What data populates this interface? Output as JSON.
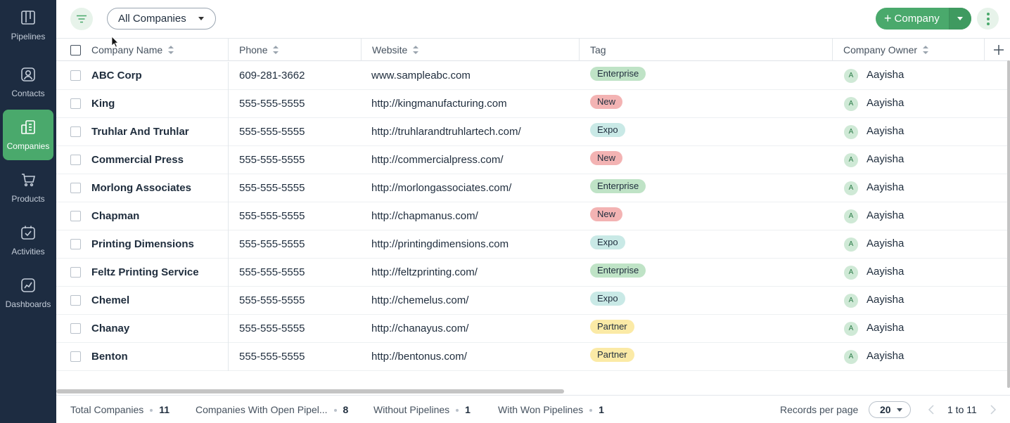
{
  "sidebar": {
    "items": [
      {
        "label": "Pipelines",
        "icon": "pipelines-icon",
        "active": false
      },
      {
        "label": "Contacts",
        "icon": "contacts-icon",
        "active": false
      },
      {
        "label": "Companies",
        "icon": "companies-icon",
        "active": true
      },
      {
        "label": "Products",
        "icon": "products-icon",
        "active": false
      },
      {
        "label": "Activities",
        "icon": "activities-icon",
        "active": false
      },
      {
        "label": "Dashboards",
        "icon": "dashboards-icon",
        "active": false
      }
    ]
  },
  "header": {
    "view_selector": "All Companies",
    "add_button_label": "Company"
  },
  "table": {
    "columns": [
      {
        "label": "Company Name",
        "sortable": true
      },
      {
        "label": "Phone",
        "sortable": true
      },
      {
        "label": "Website",
        "sortable": true
      },
      {
        "label": "Tag",
        "sortable": false
      },
      {
        "label": "Company Owner",
        "sortable": true
      }
    ],
    "rows": [
      {
        "name": "ABC Corp",
        "phone": "609-281-3662",
        "website": "www.sampleabc.com",
        "tag": "Enterprise",
        "owner": "Aayisha",
        "owner_initial": "A"
      },
      {
        "name": "King",
        "phone": "555-555-5555",
        "website": "http://kingmanufacturing.com",
        "tag": "New",
        "owner": "Aayisha",
        "owner_initial": "A"
      },
      {
        "name": "Truhlar And Truhlar",
        "phone": "555-555-5555",
        "website": "http://truhlarandtruhlartech.com/",
        "tag": "Expo",
        "owner": "Aayisha",
        "owner_initial": "A"
      },
      {
        "name": "Commercial Press",
        "phone": "555-555-5555",
        "website": "http://commercialpress.com/",
        "tag": "New",
        "owner": "Aayisha",
        "owner_initial": "A"
      },
      {
        "name": "Morlong Associates",
        "phone": "555-555-5555",
        "website": "http://morlongassociates.com/",
        "tag": "Enterprise",
        "owner": "Aayisha",
        "owner_initial": "A"
      },
      {
        "name": "Chapman",
        "phone": "555-555-5555",
        "website": "http://chapmanus.com/",
        "tag": "New",
        "owner": "Aayisha",
        "owner_initial": "A"
      },
      {
        "name": "Printing Dimensions",
        "phone": "555-555-5555",
        "website": "http://printingdimensions.com",
        "tag": "Expo",
        "owner": "Aayisha",
        "owner_initial": "A"
      },
      {
        "name": "Feltz Printing Service",
        "phone": "555-555-5555",
        "website": "http://feltzprinting.com/",
        "tag": "Enterprise",
        "owner": "Aayisha",
        "owner_initial": "A"
      },
      {
        "name": "Chemel",
        "phone": "555-555-5555",
        "website": "http://chemelus.com/",
        "tag": "Expo",
        "owner": "Aayisha",
        "owner_initial": "A"
      },
      {
        "name": "Chanay",
        "phone": "555-555-5555",
        "website": "http://chanayus.com/",
        "tag": "Partner",
        "owner": "Aayisha",
        "owner_initial": "A"
      },
      {
        "name": "Benton",
        "phone": "555-555-5555",
        "website": "http://bentonus.com/",
        "tag": "Partner",
        "owner": "Aayisha",
        "owner_initial": "A"
      }
    ]
  },
  "tag_colors": {
    "Enterprise": "#bfe3c6",
    "New": "#f3b3b3",
    "Expo": "#c9e9e6",
    "Partner": "#fbeaa6"
  },
  "colors": {
    "accent": "#4aa96c",
    "sidebar_bg": "#1d2c41"
  },
  "footer": {
    "stats": [
      {
        "label": "Total Companies",
        "value": "11"
      },
      {
        "label": "Companies With Open Pipel...",
        "value": "8"
      },
      {
        "label": "Without Pipelines",
        "value": "1"
      },
      {
        "label": "With Won Pipelines",
        "value": "1"
      }
    ],
    "records_per_page_label": "Records per page",
    "records_per_page_value": "20",
    "pagination_text": "1 to 11"
  }
}
